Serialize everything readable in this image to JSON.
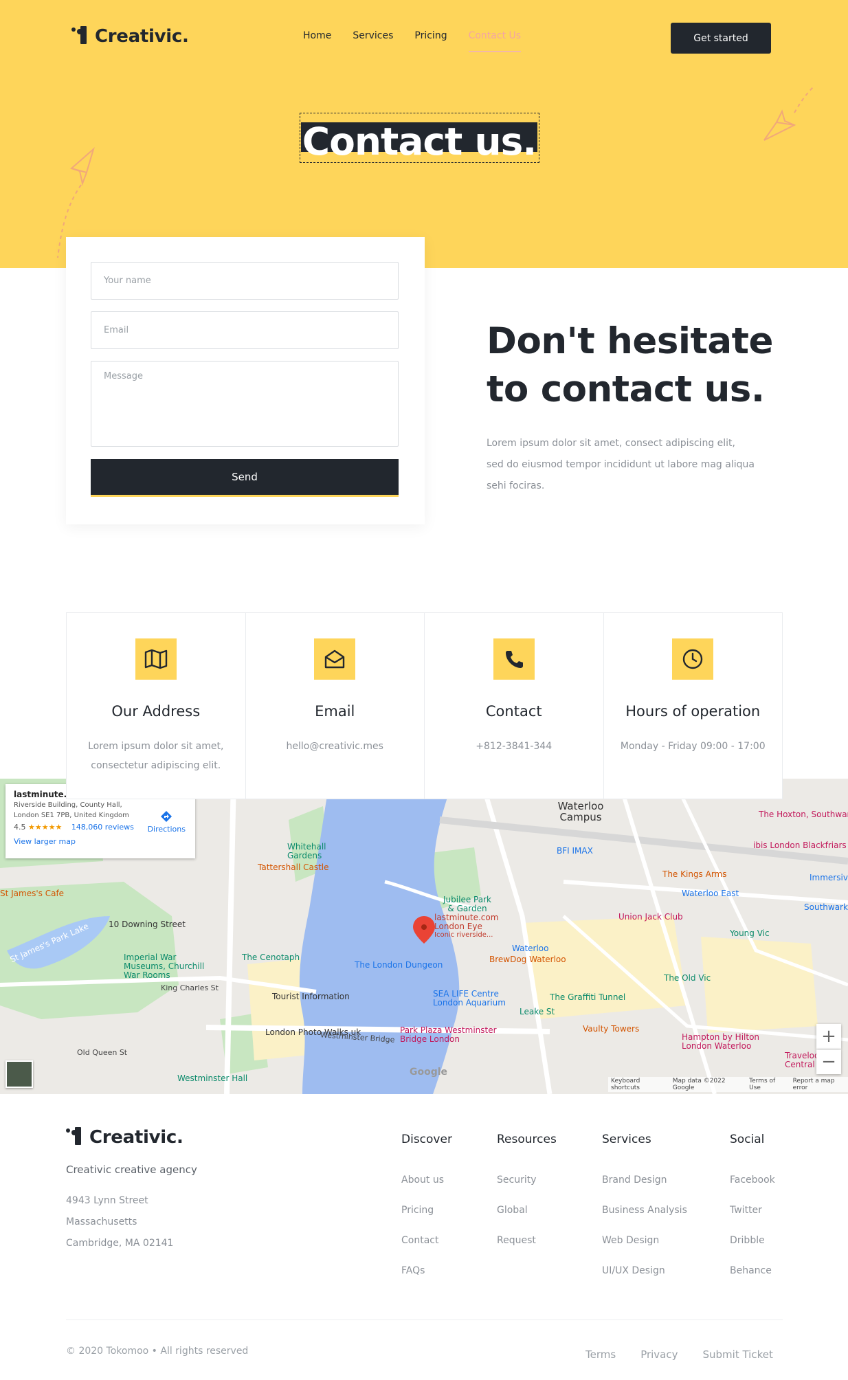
{
  "brand": {
    "name": "Creativic."
  },
  "nav": {
    "items": [
      "Home",
      "Services",
      "Pricing",
      "Contact Us"
    ],
    "cta": "Get started"
  },
  "hero": {
    "title": "Contact us."
  },
  "form": {
    "name_placeholder": "Your name",
    "email_placeholder": "Email",
    "message_placeholder": "Message",
    "send_label": "Send"
  },
  "intro": {
    "heading_line1": "Don't hesitate",
    "heading_line2": "to contact us.",
    "text": "Lorem ipsum dolor sit amet, consect adipiscing elit, sed do eiusmod tempor incididunt ut labore mag aliqua sehi fociras."
  },
  "info_cards": [
    {
      "icon": "map-icon",
      "title": "Our Address",
      "text": "Lorem ipsum dolor sit amet, consectetur adipiscing elit."
    },
    {
      "icon": "envelope-icon",
      "title": "Email",
      "text": "hello@creativic.mes"
    },
    {
      "icon": "phone-icon",
      "title": "Contact",
      "text": "+812-3841-344"
    },
    {
      "icon": "clock-icon",
      "title": "Hours of operation",
      "text": "Monday - Friday 09:00 - 17:00"
    }
  ],
  "map": {
    "place_name": "lastminute.com London Eye",
    "place_address_line1": "Riverside Building, County Hall,",
    "place_address_line2": "London SE1 7PB, United Kingdom",
    "rating": "4.5",
    "stars": "★★★★★",
    "reviews": "148,060 reviews",
    "directions": "Directions",
    "larger_map": "View larger map",
    "footer_items": [
      "Keyboard shortcuts",
      "Map data ©2022 Google",
      "Terms of Use",
      "Report a map error"
    ],
    "labels": [
      "Westminster Bridge",
      "The London Dungeon",
      "SEA LIFE Centre London Aquarium",
      "Park Plaza Westminster Bridge London",
      "Vaulty Towers",
      "Hampton by Hilton London Waterloo",
      "The Graffiti Tunnel",
      "Leake St",
      "Waterloo",
      "BrewDog Waterloo",
      "Union Jack Club",
      "Waterloo East",
      "The Kings Arms",
      "Young Vic",
      "The Old Vic",
      "Tourist Information",
      "London Photo Walks.uk",
      "Westminster Hall",
      "The Cenotaph",
      "Imperial War Museums, Churchill War Rooms",
      "10 Downing Street",
      "St James's Park Lake",
      "St James's Cafe",
      "Whitehall Gardens",
      "Tattershall Castle",
      "King's College London Waterloo Campus",
      "BFI IMAX",
      "ibis London Blackfriars",
      "The Hoxton, Southwark",
      "Immersive London",
      "Southwark",
      "Jubilee Park & Garden",
      "lastminute.com London Eye",
      "Iconic riverside...",
      "Old Queen St",
      "King Charles St",
      "Travelodge Central"
    ]
  },
  "footer": {
    "tagline": "Creativic creative agency",
    "address": [
      "4943  Lynn Street",
      "Massachusetts",
      "Cambridge, MA 02141"
    ],
    "columns": [
      {
        "title": "Discover",
        "items": [
          "About us",
          "Pricing",
          "Contact",
          "FAQs"
        ]
      },
      {
        "title": "Resources",
        "items": [
          "Security",
          "Global",
          "Request"
        ]
      },
      {
        "title": "Services",
        "items": [
          "Brand Design",
          "Business Analysis",
          "Web Design",
          "UI/UX Design"
        ]
      },
      {
        "title": "Social",
        "items": [
          "Facebook",
          "Twitter",
          "Dribble",
          "Behance"
        ]
      }
    ],
    "copyright": "© 2020 Tokomoo • All rights reserved",
    "links": [
      "Terms",
      "Privacy",
      "Submit Ticket"
    ]
  },
  "colors": {
    "accent": "#fed55a",
    "dark": "#22272e",
    "muted": "#8b9097",
    "active_nav": "#f4a5a3"
  }
}
